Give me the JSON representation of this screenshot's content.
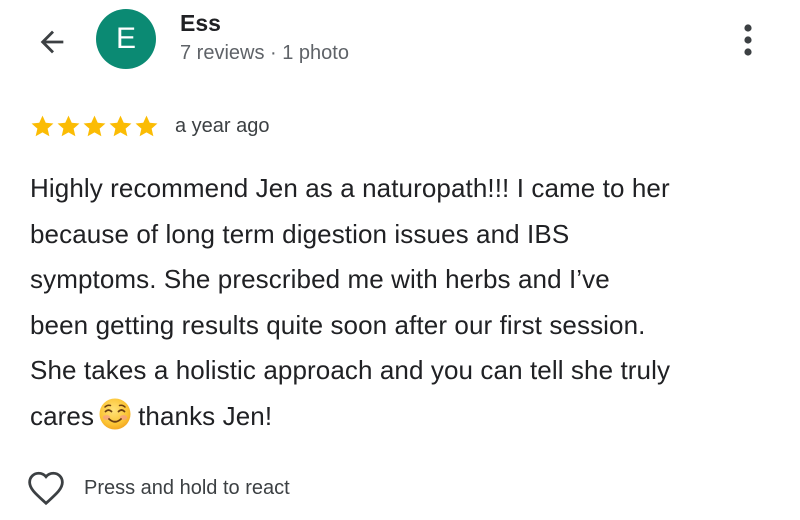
{
  "header": {
    "back_icon": "arrow-left-icon",
    "avatar_letter": "E",
    "avatar_color": "#0b8a73",
    "reviewer_name": "Ess",
    "reviewer_meta": "7 reviews · 1 photo",
    "more_icon": "more-vertical-icon"
  },
  "review": {
    "rating": 5,
    "max_rating": 5,
    "star_color": "#fbbc04",
    "time_ago": "a year ago",
    "lines": [
      "Highly recommend Jen as a naturopath!!! I came to her",
      "because of long term digestion issues and IBS",
      "symptoms. She prescribed me with herbs and I’ve",
      "been getting results quite soon after our first session.",
      "She takes a holistic approach and you can tell she truly"
    ],
    "last_line_before": "cares",
    "emoji": "smiling-face-icon",
    "last_line_after": "thanks Jen!"
  },
  "react": {
    "icon": "heart-outline-icon",
    "label": "Press and hold to react"
  }
}
